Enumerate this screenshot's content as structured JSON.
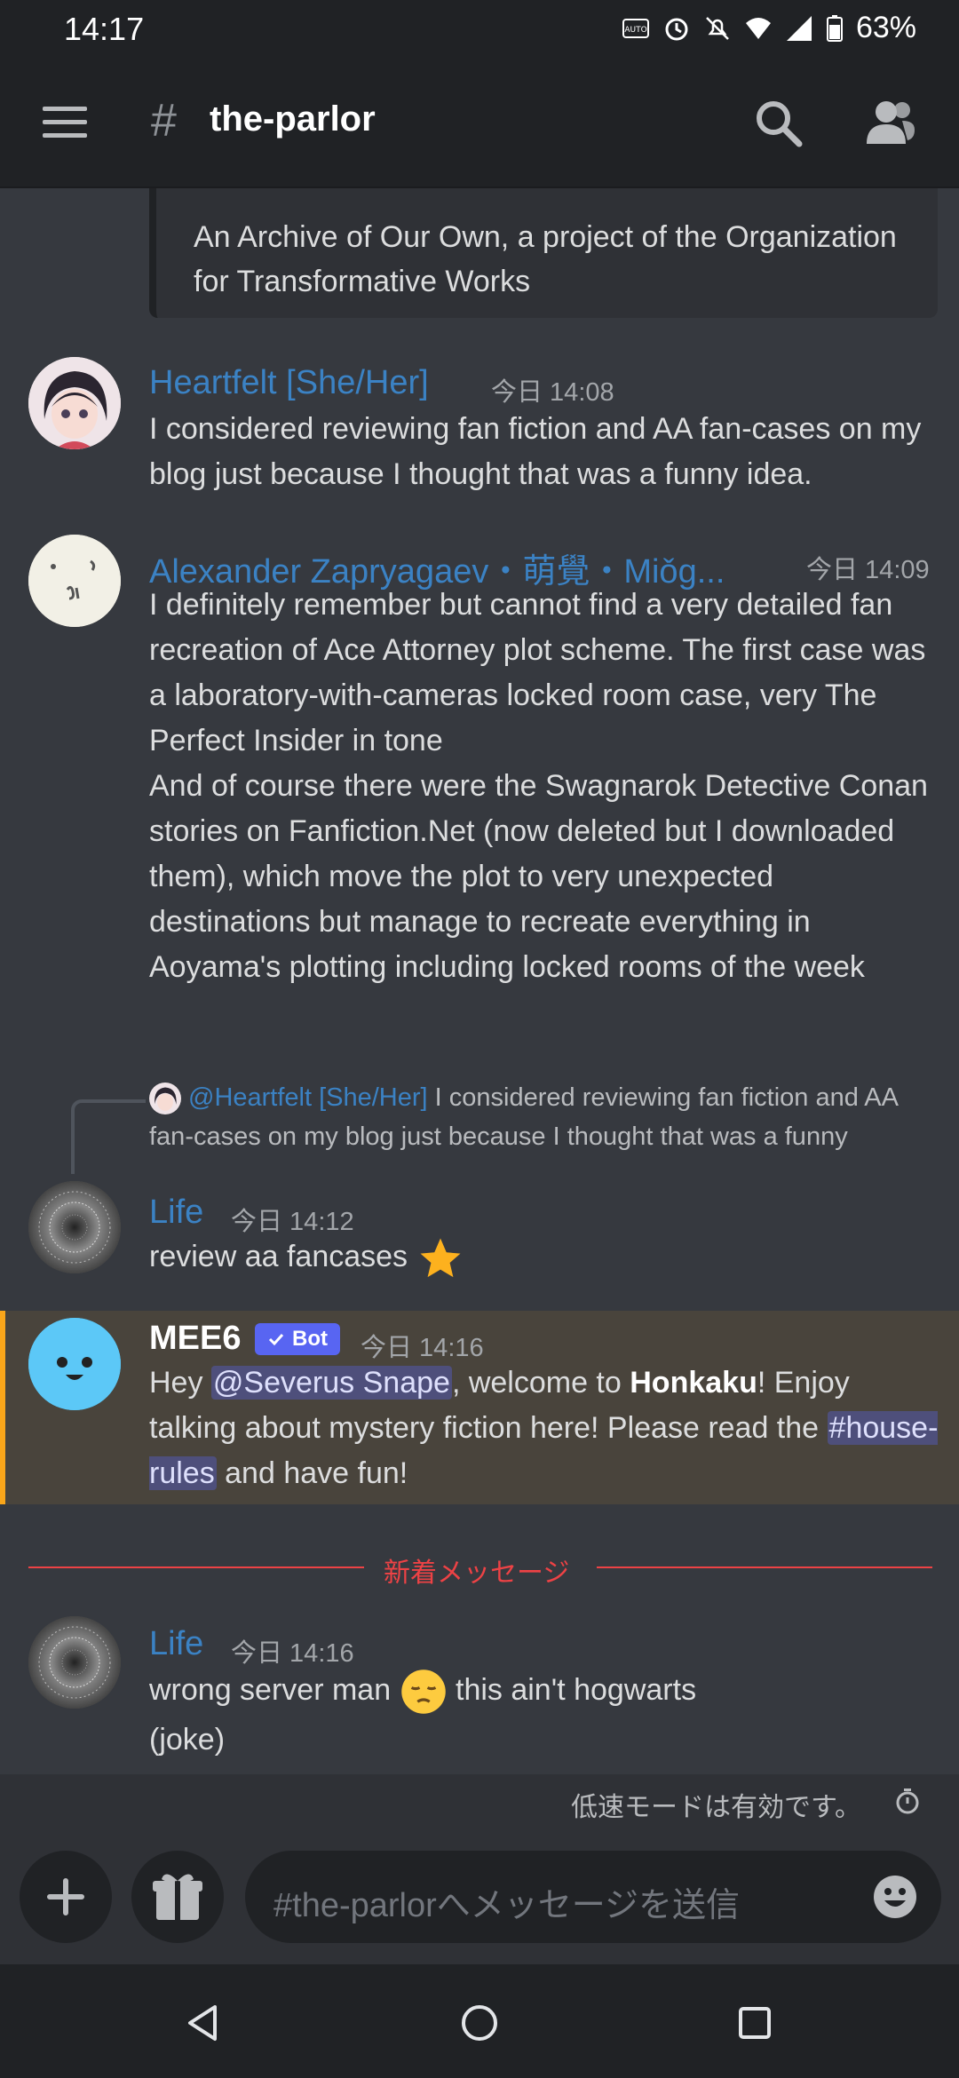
{
  "status_bar": {
    "time": "14:17",
    "battery": "63%",
    "icons": [
      "auto-hdr-icon",
      "alarm-icon",
      "mute-icon",
      "wifi-icon",
      "signal-icon",
      "battery-icon"
    ]
  },
  "header": {
    "channel_hash": "#",
    "channel_name": "the-parlor",
    "icons": [
      "menu-icon",
      "search-icon",
      "members-icon"
    ]
  },
  "embed": {
    "description": "An Archive of Our Own, a project of the Organization for Transformative Works"
  },
  "messages": [
    {
      "username": "Heartfelt [She/Her]",
      "timestamp": "今日 14:08",
      "text": "I considered reviewing fan fiction and AA fan-cases on my blog just because I thought that was a funny idea."
    },
    {
      "username": "Alexander Zapryagaev・萌覺・Miǒg...",
      "timestamp": "今日 14:09",
      "text1": "I definitely remember but cannot find a very detailed fan recreation of Ace Attorney plot scheme. The first case was a laboratory-with-cameras locked room case, very The Perfect Insider in tone",
      "text2": "And of course there were the Swagnarok Detective Conan stories on Fanfiction.Net (now deleted but I downloaded them), which move the plot to very unexpected destinations but manage to recreate everything in Aoyama's plotting including locked rooms of the week"
    },
    {
      "reply_name": "@Heartfelt [She/Her]",
      "reply_text": "I considered reviewing fan fiction and AA fan-cases on my blog just because I thought that was a funny",
      "username": "Life",
      "timestamp": "今日 14:12",
      "text": "review aa fancases"
    },
    {
      "username": "MEE6",
      "bot_badge": "Bot",
      "timestamp": "今日 14:16",
      "text_a": "Hey ",
      "mention": "@Severus Snape",
      "text_b": ", welcome to ",
      "server": "Honkaku",
      "text_c": "! Enjoy talking about mystery fiction here! Please read the ",
      "channel_mention": "#house-rules",
      "text_d": " and have fun!"
    },
    {
      "username": "Life",
      "timestamp": "今日 14:16",
      "text_a": "wrong server man ",
      "text_b": " this ain't hogwarts",
      "text_c": "(joke)"
    }
  ],
  "divider": {
    "label": "新着メッセージ"
  },
  "slowmode": {
    "text": "低速モードは有効です。"
  },
  "composer": {
    "placeholder": "#the-parlorへメッセージを送信"
  },
  "colors": {
    "background": "#36393f",
    "header": "#202225",
    "username": "#3b82c4",
    "accent": "#5865f2",
    "new_divider": "#ed4245",
    "highlight": "#49443c",
    "highlight_bar": "#faa61a"
  }
}
